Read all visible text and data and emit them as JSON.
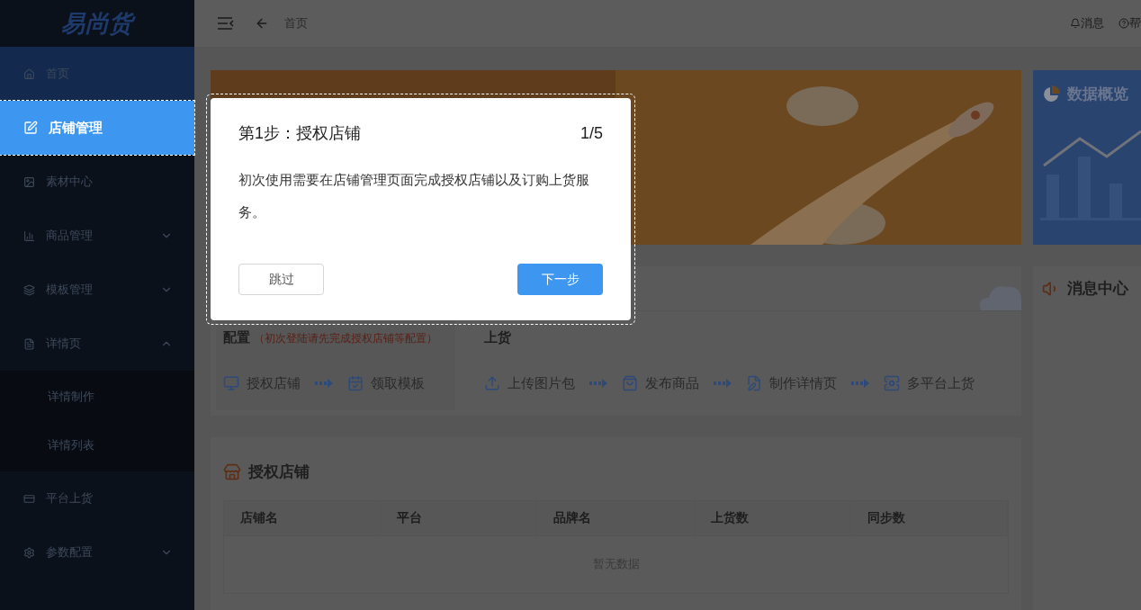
{
  "sidebar": {
    "logo": "易尚货",
    "items": [
      {
        "label": "首页",
        "selected": false,
        "active": true
      },
      {
        "label": "店铺管理",
        "selected": true
      },
      {
        "label": "素材中心",
        "selected": false
      },
      {
        "label": "商品管理",
        "selected": false,
        "expanded": false
      },
      {
        "label": "模板管理",
        "selected": false,
        "expanded": false
      },
      {
        "label": "详情页",
        "selected": false,
        "expanded": true,
        "children": [
          {
            "label": "详情制作"
          },
          {
            "label": "详情列表"
          }
        ]
      },
      {
        "label": "平台上货",
        "selected": false
      },
      {
        "label": "参数配置",
        "selected": false,
        "expanded": false
      }
    ]
  },
  "header": {
    "breadcrumb": "首页",
    "actions": [
      "消息",
      "帮"
    ]
  },
  "overview_card": {
    "title": "数据概览"
  },
  "message_center": {
    "title": "消息中心"
  },
  "workflow": {
    "config": {
      "title": "配置",
      "note": "（初次登陆请先完成授权店铺等配置）",
      "steps": [
        "授权店铺",
        "领取模板"
      ]
    },
    "upload": {
      "title": "上货",
      "steps": [
        "上传图片包",
        "发布商品",
        "制作详情页",
        "多平台上货"
      ]
    }
  },
  "stores": {
    "title": "授权店铺",
    "columns": [
      "店铺名",
      "平台",
      "品牌名",
      "上货数",
      "同步数"
    ],
    "empty": "暂无数据"
  },
  "guide": {
    "title": "第1步：授权店铺",
    "progress": "1/5",
    "body": "初次使用需要在店铺管理页面完成授权店铺以及订购上货服务。",
    "skip": "跳过",
    "next": "下一步"
  }
}
